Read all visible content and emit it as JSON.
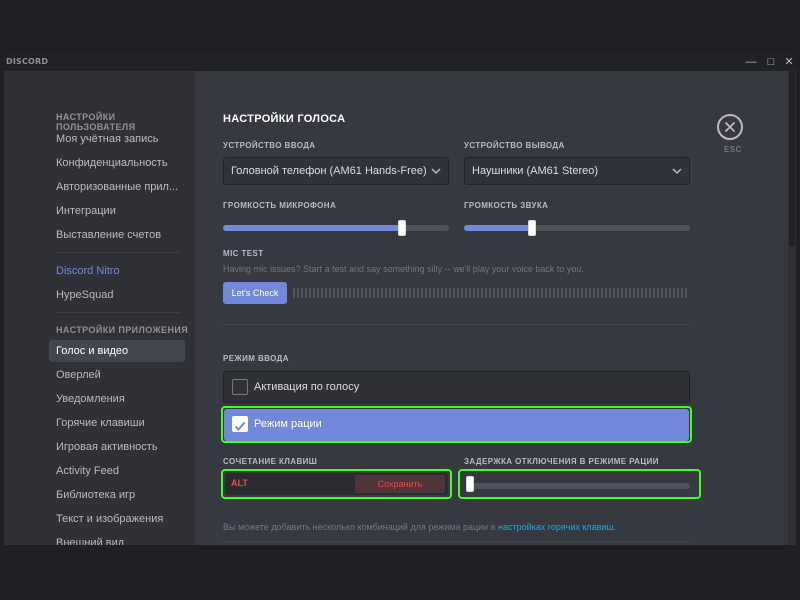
{
  "window": {
    "brand": "DISCORD",
    "minimize": "—",
    "maximize": "□",
    "close": "✕"
  },
  "sidebar": {
    "user_settings_heading": "НАСТРОЙКИ ПОЛЬЗОВАТЕЛЯ",
    "user_items": [
      {
        "label": "Моя учётная запись"
      },
      {
        "label": "Конфиденциальность"
      },
      {
        "label": "Авторизованные прил..."
      },
      {
        "label": "Интеграции"
      },
      {
        "label": "Выставление счетов"
      }
    ],
    "nitro": "Discord Nitro",
    "hypesquad": "HypeSquad",
    "app_settings_heading": "НАСТРОЙКИ ПРИЛОЖЕНИЯ",
    "app_items": [
      {
        "label": "Голос и видео",
        "active": true
      },
      {
        "label": "Оверлей"
      },
      {
        "label": "Уведомления"
      },
      {
        "label": "Горячие клавиши"
      },
      {
        "label": "Игровая активность"
      },
      {
        "label": "Activity Feed"
      },
      {
        "label": "Библиотека игр"
      },
      {
        "label": "Текст и изображения"
      },
      {
        "label": "Внешний вид"
      }
    ]
  },
  "main": {
    "title": "НАСТРОЙКИ ГОЛОСА",
    "esc_label": "ESC",
    "input_device_label": "УСТРОЙСТВО ВВОДА",
    "input_device_value": "Головной телефон (AM61 Hands-Free)",
    "output_device_label": "УСТРОЙСТВО ВЫВОДА",
    "output_device_value": "Наушники (AM61 Stereo)",
    "mic_volume_label": "ГРОМКОСТЬ МИКРОФОНА",
    "mic_volume_level": 0.79,
    "output_volume_label": "ГРОМКОСТЬ ЗВУКА",
    "output_volume_level": 0.3,
    "mic_test_label": "MIC TEST",
    "mic_test_desc": "Having mic issues? Start a test and say something silly -- we'll play your voice back to you.",
    "lets_check": "Let's Check",
    "input_mode_label": "РЕЖИМ ВВОДА",
    "mode_voice_activity": "Активация по голосу",
    "mode_push_to_talk": "Режим рации",
    "shortcut_label": "СОЧЕТАНИЕ КЛАВИШ",
    "shortcut_key": "ALT",
    "shortcut_save": "Сохранить",
    "release_delay_label": "ЗАДЕРЖКА ОТКЛЮЧЕНИЯ В РЕЖИМЕ РАЦИИ",
    "release_delay_level": 0.02,
    "footer_text": "Вы можете добавить несколько комбинаций для режима рации в ",
    "footer_link": "настройках горячих клавиш",
    "footer_end": "."
  },
  "colors": {
    "accent": "#7289da",
    "highlight_outline": "#43ff1b",
    "danger": "#f04747",
    "link": "#00b0f4"
  }
}
